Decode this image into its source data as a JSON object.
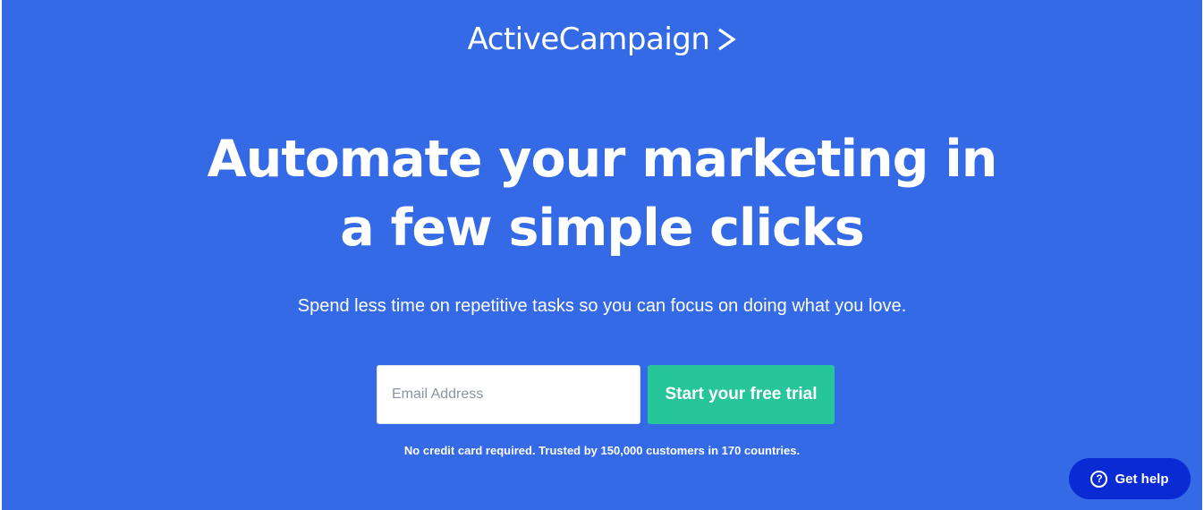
{
  "brand": {
    "logo_text": "ActiveCampaign",
    "logo_icon": "chevron-right-icon"
  },
  "hero": {
    "headline_line1": "Automate your marketing in",
    "headline_line2": "a few simple clicks",
    "subheadline": "Spend less time on repetitive tasks so you can focus on doing what you love.",
    "background_color": "#356ae6"
  },
  "signup_form": {
    "email_value": "",
    "email_placeholder": "Email Address",
    "submit_label": "Start your free trial",
    "submit_color": "#27c59a",
    "disclaimer": "No credit card required. Trusted by 150,000 customers in 170 countries."
  },
  "help_widget": {
    "label": "Get help",
    "icon": "question-circle-icon",
    "icon_glyph": "?",
    "color": "#0a2bd4"
  }
}
